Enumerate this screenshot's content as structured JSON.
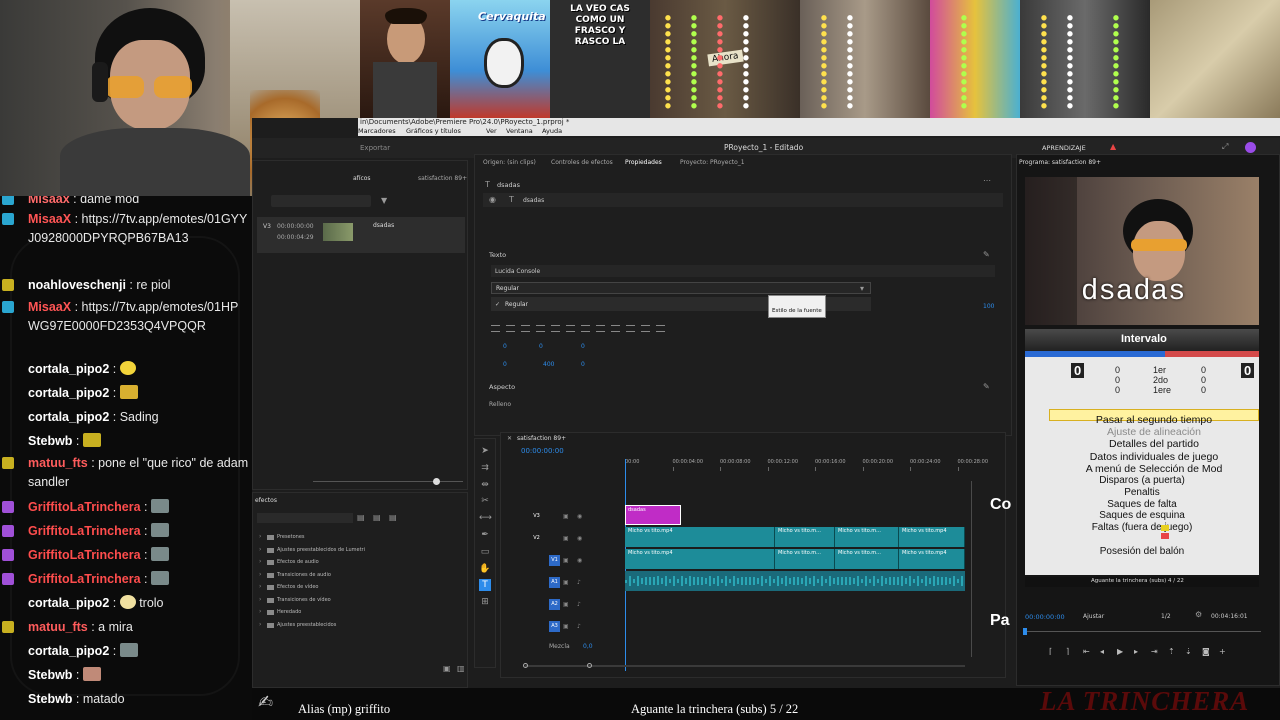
{
  "collage": {
    "brand_caption": "Cervaquita",
    "meme_caption": "LA VEO CAS COMO UN FRASCO Y RASCO LA",
    "sticker": "Ahora"
  },
  "chat": {
    "messages": [
      {
        "user": "Misaax",
        "text": "dame mod",
        "color": "#ff6b6b",
        "badge": "mod",
        "emote": null
      },
      {
        "user": "MisaaX",
        "text": "https://7tv.app/emotes/01GYYJ0928000DPYRQPB67BA13",
        "color": "#ff5555",
        "badge": "mod",
        "emote": null
      },
      {
        "user": "noahloveschenji",
        "text": "re piol",
        "color": "#ffffff",
        "badge": "sub",
        "emote": null
      },
      {
        "user": "MisaaX",
        "text": "https://7tv.app/emotes/01HPWG97E0000FD2353Q4VPQQR",
        "color": "#ff5555",
        "badge": "mod",
        "emote": null
      },
      {
        "user": "cortala_pipo2",
        "text": "",
        "color": "#ffffff",
        "badge": null,
        "emote": "yellow-face"
      },
      {
        "user": "cortala_pipo2",
        "text": "",
        "color": "#ffffff",
        "badge": null,
        "emote": "dots"
      },
      {
        "user": "cortala_pipo2",
        "text": "Sading",
        "color": "#ffffff",
        "badge": null,
        "emote": null
      },
      {
        "user": "Stebwb",
        "text": "",
        "color": "#ffffff",
        "badge": null,
        "emote": "frog"
      },
      {
        "user": "matuu_fts",
        "text": "pone el \"que rico\" de adam sandler",
        "color": "#ff5c5c",
        "badge": "sub",
        "emote": null
      },
      {
        "user": "GriffitoLaTrinchera",
        "text": "",
        "color": "#ff4d4d",
        "badge": "vip",
        "emote": "cat"
      },
      {
        "user": "GriffitoLaTrinchera",
        "text": "",
        "color": "#ff4d4d",
        "badge": "vip",
        "emote": "cat"
      },
      {
        "user": "GriffitoLaTrinchera",
        "text": "",
        "color": "#ff4d4d",
        "badge": "vip",
        "emote": "cat"
      },
      {
        "user": "GriffitoLaTrinchera",
        "text": "",
        "color": "#ff4d4d",
        "badge": "vip",
        "emote": "cat"
      },
      {
        "user": "cortala_pipo2",
        "text": "trolo",
        "color": "#ffffff",
        "badge": null,
        "emote": "egg"
      },
      {
        "user": "matuu_fts",
        "text": "a mira",
        "color": "#ff5c5c",
        "badge": "sub",
        "emote": null
      },
      {
        "user": "cortala_pipo2",
        "text": "",
        "color": "#ffffff",
        "badge": null,
        "emote": "cat"
      },
      {
        "user": "Stebwb",
        "text": "",
        "color": "#ffffff",
        "badge": null,
        "emote": "face"
      },
      {
        "user": "Stebwb",
        "text": "matado",
        "color": "#ffffff",
        "badge": null,
        "emote": null
      }
    ]
  },
  "premiere": {
    "window_path": "in\\Documents\\Adobe\\Premiere Pro\\24.0\\PRoyecto_1.prproj *",
    "menu": [
      "Marcadores",
      "Gráficos y títulos",
      "Ver",
      "Ventana",
      "Ayuda"
    ],
    "export_label": "Exportar",
    "project_title": "PRoyecto_1 - Editado",
    "learn_label": "APRENDIZAJE",
    "tabs": [
      "Origen: (sin clips)",
      "Controles de efectos",
      "Propiedades",
      "Proyecto: PRoyecto_1"
    ],
    "program_tab": "Programa: satisfaction 89+",
    "seq_tab": "satisfaction 89+",
    "clip_tc1": "00:00:00:00",
    "clip_tc2": "00:00:04:29",
    "clip_name": "dsadas",
    "layer_name": "dsadas",
    "text_layer": "dsadas",
    "section_text": "Texto",
    "font": "Lucida Console",
    "style": "Regular",
    "style_option": "Regular",
    "tooltip": "Estilo de la fuente",
    "size_value": "100",
    "section_aspect": "Aspecto",
    "fill_label": "Relleno",
    "num_a": "0",
    "num_b": "0",
    "num_c": "0",
    "num_d": "0",
    "num_e": "400",
    "num_f": "0",
    "effects_tab": "efectos",
    "effects_tree": [
      "Presetones",
      "Ajustes preestablecidos de Lumetri",
      "Efectos de audio",
      "Transiciones de audio",
      "Efectos de vídeo",
      "Transiciones de vídeo",
      "Heredado",
      "Ajustes preestablecidos"
    ],
    "timeline_tab": "satisfaction 89+",
    "timeline_tc": "00:00:00:00",
    "ruler": [
      "00:00",
      "00:00:04:00",
      "00:00:08:00",
      "00:00:12:00",
      "00:00:16:00",
      "00:00:20:00",
      "00:00:24:00",
      "00:00:28:00"
    ],
    "tracks_video": [
      "V3",
      "V2",
      "V1"
    ],
    "tracks_audio": [
      "A1",
      "A2",
      "A3"
    ],
    "mix_label": "Mezcla",
    "mix_value": "0,0",
    "clip_labels": [
      "Micho vs tito.mp4",
      "Micho vs tito.m...",
      "Micho vs tito.m...",
      "Micho vs tito.mp4"
    ],
    "title_clip": "dsadas",
    "program_overlay_text": "dsadas",
    "program_tc": "00:00:00:00",
    "program_fit": "Ajustar",
    "program_res": "1/2",
    "program_duration": "00:04:16:01",
    "side_text_1": "Co",
    "side_text_2": "Pa"
  },
  "game_menu": {
    "header": "Intervalo",
    "score_left": "0",
    "score_right": "0",
    "rows": [
      [
        "0",
        "1er",
        "0"
      ],
      [
        "0",
        "2do",
        "0"
      ],
      [
        "0",
        "1ere",
        "0"
      ]
    ],
    "items": [
      "Pasar al segundo tiempo",
      "Ajuste de alineación",
      "Detalles del partido",
      "Datos individuales de juego",
      "A menú de Selección de Mod"
    ],
    "stats": [
      "Disparos (a puerta)",
      "Penaltis",
      "Saques de falta",
      "Saques de esquina",
      "Faltas (fuera de juego)",
      "",
      "Posesión del balón"
    ],
    "footer_caption": "Aguante la trinchera (subs) 4 / 22"
  },
  "bottom": {
    "alias": "Alias (mp) griffito",
    "subs": "Aguante la trinchera (subs) 5 / 22",
    "brand": "LA TRINCHERA"
  },
  "colors": {
    "accent_blue": "#2d8ceb",
    "clip_teal": "#1d8c99",
    "clip_magenta": "#c02cc6",
    "audio_green": "#2aa6b5"
  }
}
